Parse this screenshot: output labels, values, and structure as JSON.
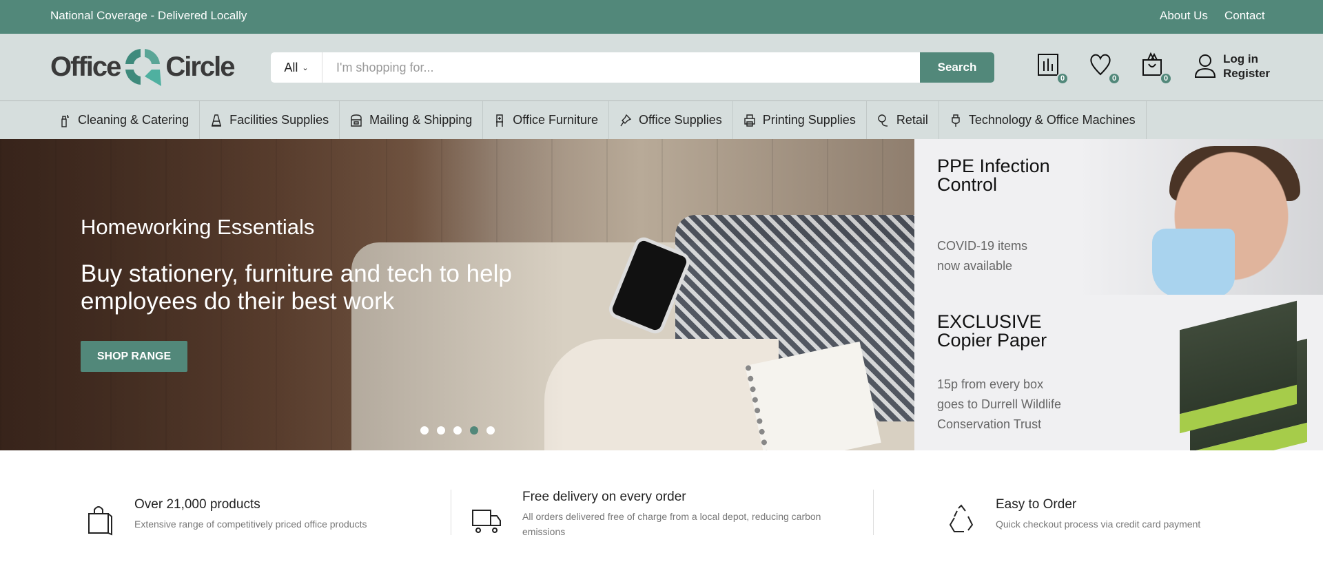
{
  "topbar": {
    "tagline": "National Coverage - Delivered Locally",
    "links": [
      "About Us",
      "Contact"
    ],
    "color": "#52887a"
  },
  "header": {
    "logo": {
      "left": "Office",
      "right": "Circle"
    },
    "search": {
      "category": "All",
      "placeholder": "I'm shopping for...",
      "value": "",
      "button": "Search"
    },
    "compare_count": "0",
    "wishlist_count": "0",
    "cart_count": "0",
    "account": {
      "login": "Log in",
      "register": "Register"
    }
  },
  "nav": {
    "items": [
      {
        "label": "Cleaning & Catering",
        "icon": "spray-bottle-icon"
      },
      {
        "label": "Facilities Supplies",
        "icon": "traffic-cone-icon"
      },
      {
        "label": "Mailing & Shipping",
        "icon": "mailbox-icon"
      },
      {
        "label": "Office Furniture",
        "icon": "chair-icon"
      },
      {
        "label": "Office Supplies",
        "icon": "pushpin-icon"
      },
      {
        "label": "Printing Supplies",
        "icon": "printer-icon"
      },
      {
        "label": "Retail",
        "icon": "price-tag-icon"
      },
      {
        "label": "Technology & Office Machines",
        "icon": "usb-plug-icon"
      }
    ]
  },
  "hero": {
    "eyebrow": "Homeworking Essentials",
    "headline": "Buy stationery, furniture and tech to help employees do their best work",
    "button": "SHOP RANGE",
    "slides": 5,
    "active_slide": 4
  },
  "promos": [
    {
      "title_line1": "PPE Infection",
      "title_line2": "Control",
      "text_line1": "COVID-19 items",
      "text_line2": "now available"
    },
    {
      "title_line1": "EXCLUSIVE",
      "title_line2": "Copier Paper",
      "text_line1": "15p from every box",
      "text_line2": "goes to Durrell Wildlife",
      "text_line3": "Conservation Trust"
    }
  ],
  "features": [
    {
      "title": "Over 21,000 products",
      "desc": "Extensive range of competitively priced office products",
      "icon": "shopping-bag-icon"
    },
    {
      "title": "Free delivery on every order",
      "desc": "All orders delivered free of charge from a local depot, reducing carbon emissions",
      "icon": "delivery-truck-icon"
    },
    {
      "title": "Easy to Order",
      "desc": "Quick checkout process via credit card payment",
      "icon": "recycle-icon"
    }
  ]
}
